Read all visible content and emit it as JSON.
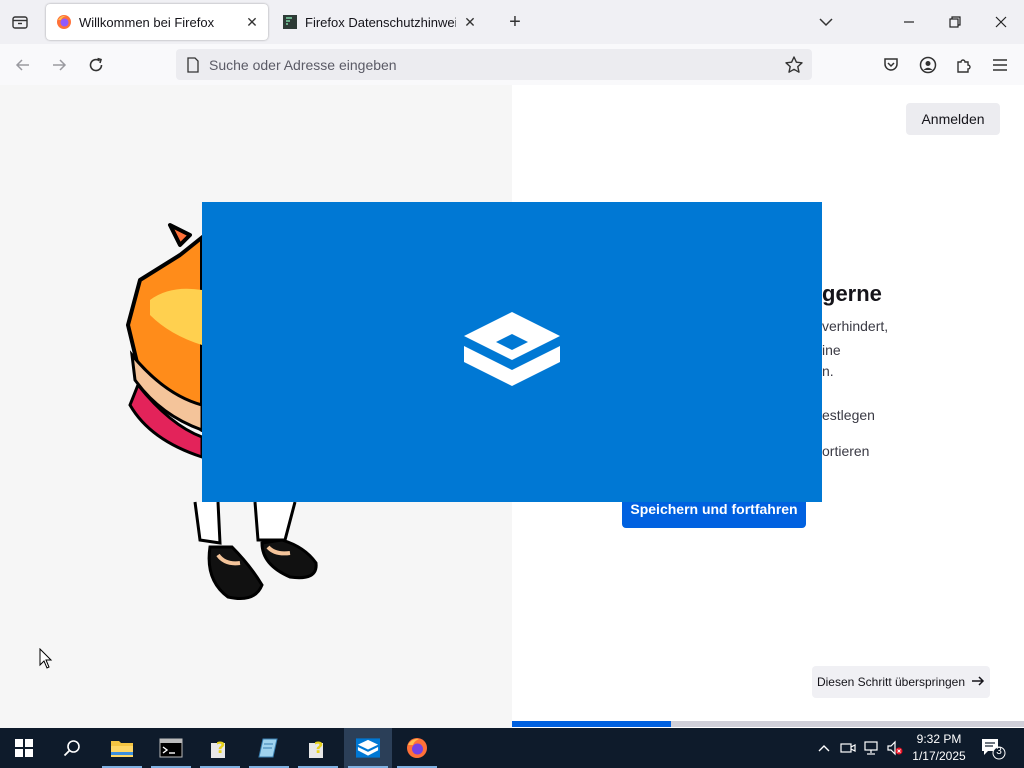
{
  "browser": {
    "tabs": [
      {
        "title": "Willkommen bei Firefox",
        "active": true
      },
      {
        "title": "Firefox Datenschutzhinweis — M",
        "active": false
      }
    ],
    "url_placeholder": "Suche oder Adresse eingeben"
  },
  "page": {
    "signin_label": "Anmelden",
    "heading_fragment": "gerne",
    "text_fragments": [
      "verhindert,",
      "ine",
      "n.",
      "estlegen",
      "ortieren"
    ],
    "primary_button": "Speichern und fortfahren",
    "skip_button": "Diesen Schritt überspringen",
    "progress_fraction": 0.31
  },
  "taskbar": {
    "apps": [
      "start",
      "search",
      "file-explorer",
      "terminal",
      "help",
      "notepad",
      "help",
      "sandbox",
      "firefox"
    ],
    "clock_time": "9:32 PM",
    "clock_date": "1/17/2025",
    "notification_count": "3"
  },
  "colors": {
    "splash": "#0078d4",
    "accent": "#0061e0",
    "taskbar": "#0e1b2b"
  }
}
